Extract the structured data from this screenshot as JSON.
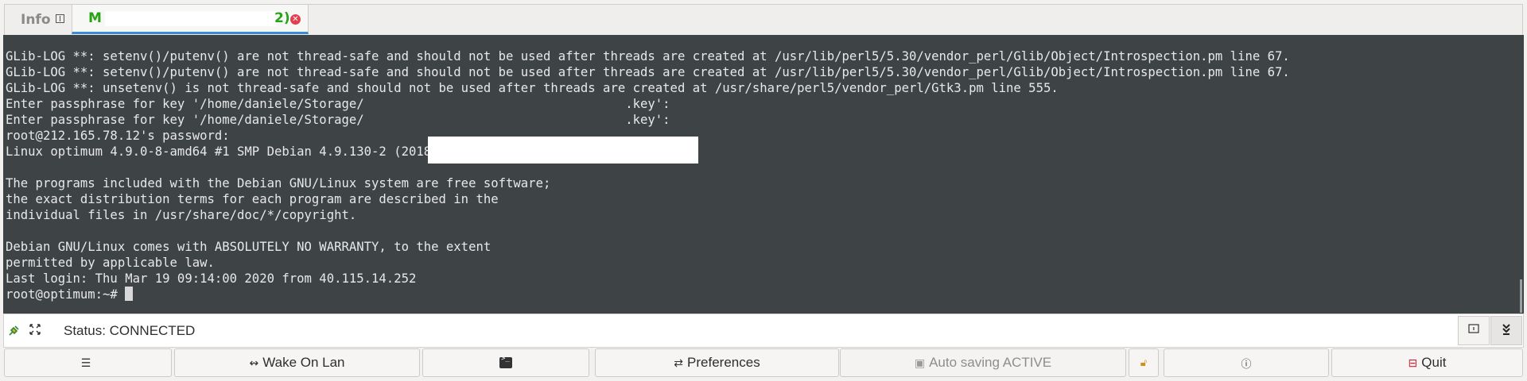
{
  "tabs": [
    {
      "label": "Info",
      "icon": "info-box-icon",
      "active": false
    },
    {
      "label_prefix": "M",
      "label_suffix": "2)",
      "icon": "close-icon",
      "active": true
    }
  ],
  "terminal": {
    "lines": [
      "GLib-LOG **: setenv()/putenv() are not thread-safe and should not be used after threads are created at /usr/lib/perl5/5.30/vendor_perl/Glib/Object/Introspection.pm line 67.",
      "GLib-LOG **: setenv()/putenv() are not thread-safe and should not be used after threads are created at /usr/lib/perl5/5.30/vendor_perl/Glib/Object/Introspection.pm line 67.",
      "GLib-LOG **: unsetenv() is not thread-safe and should not be used after threads are created at /usr/share/perl5/vendor_perl/Gtk3.pm line 555.",
      "Enter passphrase for key '/home/daniele/Storage/                                   .key':",
      "Enter passphrase for key '/home/daniele/Storage/                                   .key':",
      "root@212.165.78.12's password:",
      "Linux optimum 4.9.0-8-amd64 #1 SMP Debian 4.9.130-2 (2018-10-27) x86_64",
      "",
      "The programs included with the Debian GNU/Linux system are free software;",
      "the exact distribution terms for each program are described in the",
      "individual files in /usr/share/doc/*/copyright.",
      "",
      "Debian GNU/Linux comes with ABSOLUTELY NO WARRANTY, to the extent",
      "permitted by applicable law.",
      "Last login: Thu Mar 19 09:14:00 2020 from 40.115.14.252"
    ],
    "prompt": "root@optimum:~# ",
    "background": "#3e4446",
    "foreground": "#e8e8e8"
  },
  "status": {
    "text": "Status: CONNECTED",
    "left_icons": [
      "plug-icon",
      "fullscreen-icon"
    ],
    "right_buttons": [
      "info-box-icon",
      "scroll-to-bottom-icon"
    ]
  },
  "buttons": [
    {
      "name": "menu-button",
      "label": "",
      "icon": "hamburger-icon",
      "enabled": true
    },
    {
      "name": "wake-on-lan-button",
      "label": "Wake On Lan",
      "icon": "arrows-icon",
      "enabled": true
    },
    {
      "name": "terminal-button",
      "label": "",
      "icon": "terminal-icon",
      "enabled": true
    },
    {
      "name": "preferences-button",
      "label": "Preferences",
      "icon": "sliders-icon",
      "enabled": true
    },
    {
      "name": "auto-saving-button",
      "label": "Auto saving ACTIVE",
      "icon": "save-icon",
      "enabled": false
    },
    {
      "name": "lock-button",
      "label": "",
      "icon": "lock-icon",
      "enabled": true
    },
    {
      "name": "about-button",
      "label": "",
      "icon": "info-icon",
      "enabled": true
    },
    {
      "name": "quit-button",
      "label": "Quit",
      "icon": "quit-icon",
      "enabled": true
    }
  ]
}
